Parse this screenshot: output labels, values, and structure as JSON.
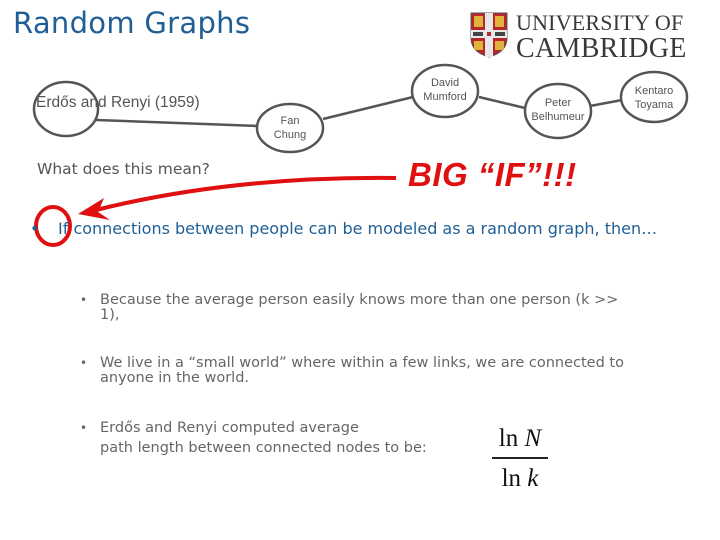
{
  "slide": {
    "title": "Random Graphs",
    "logo": {
      "line1": "UNIVERSITY OF",
      "line2": "CAMBRIDGE"
    },
    "graph": {
      "nodes": [
        {
          "id": "erdos",
          "label": "Erdős"
        },
        {
          "id": "fan",
          "line1": "Fan",
          "line2": "Chung"
        },
        {
          "id": "david",
          "line1": "David",
          "line2": "Mumford"
        },
        {
          "id": "peter",
          "line1": "Peter",
          "line2": "Belhumeur"
        },
        {
          "id": "kentaro",
          "line1": "Kentaro",
          "line2": "Toyama"
        }
      ],
      "er_label": "Erdős and Renyi (1959)"
    },
    "question": "What does this mean?",
    "annotation": "BIG “IF”!!!",
    "annotation_color": "#e01010",
    "bullets": [
      {
        "text": "If connections between people can be modeled as a random graph, then…"
      }
    ],
    "sub_bullets": [
      {
        "line1": "Because the average person easily knows more than one person (k  >>",
        "line2": "1),"
      },
      {
        "line1": "We live in a “small world” where within a few links, we are connected to",
        "line2": "anyone in the world."
      },
      {
        "line1": "Erdős and Renyi computed average",
        "line2": "path length between connected nodes to be:"
      }
    ],
    "formula": {
      "num_fn": "ln",
      "num_var": "N",
      "den_fn": "ln",
      "den_var": "k"
    },
    "bullet_glyph": "•",
    "colors": {
      "title": "#1f5f96",
      "body": "#666666",
      "accent": "#e01010"
    }
  }
}
